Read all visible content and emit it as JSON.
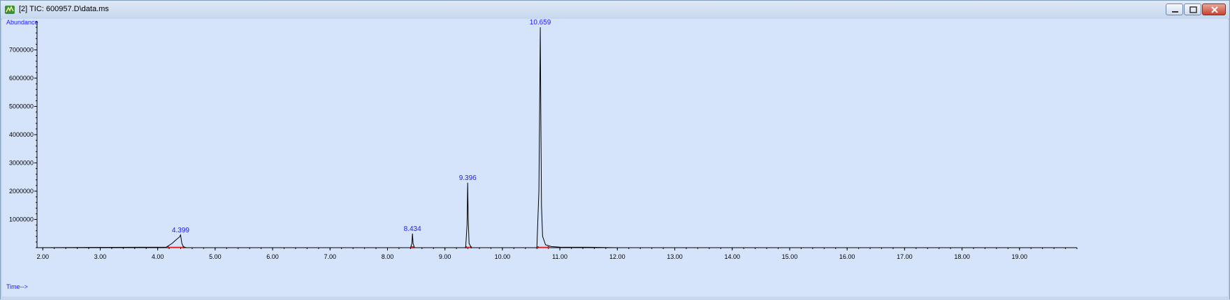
{
  "window": {
    "title": "[2] TIC: 600957.D\\data.ms",
    "icons": {
      "app": "chromatogram-app-icon",
      "minimize": "minimize-icon",
      "maximize": "maximize-icon",
      "close": "close-icon"
    }
  },
  "colors": {
    "plot_background": "#d6e4fb",
    "trace": "#000000",
    "labels": "#1a1aff",
    "baseline_markers": "#e02020"
  },
  "chart_data": {
    "type": "line",
    "title": "",
    "ylabel": "Abundance",
    "xlabel": "Time-->",
    "xlim": [
      1.9,
      20.0
    ],
    "ylim": [
      0,
      8000000
    ],
    "x_ticks": [
      "2.00",
      "3.00",
      "4.00",
      "5.00",
      "6.00",
      "7.00",
      "8.00",
      "9.00",
      "10.00",
      "11.00",
      "12.00",
      "13.00",
      "14.00",
      "15.00",
      "16.00",
      "17.00",
      "18.00",
      "19.00"
    ],
    "y_ticks": [
      "1000000",
      "2000000",
      "3000000",
      "4000000",
      "5000000",
      "6000000",
      "7000000"
    ],
    "grid": false,
    "series": [
      {
        "x": [
          1.9,
          4.15,
          4.25,
          4.32,
          4.38,
          4.399,
          4.42,
          4.45,
          4.5,
          8.4,
          8.425,
          8.434,
          8.445,
          8.47,
          9.36,
          9.385,
          9.396,
          9.405,
          9.42,
          9.46,
          10.6,
          10.635,
          10.648,
          10.659,
          10.668,
          10.68,
          10.7,
          10.75,
          10.85,
          11.0,
          11.5,
          12.0,
          14.5,
          20.0
        ],
        "y": [
          0,
          20000,
          150000,
          280000,
          380000,
          450000,
          150000,
          30000,
          0,
          0,
          150000,
          500000,
          150000,
          0,
          0,
          800000,
          2300000,
          1000000,
          150000,
          0,
          0,
          2000000,
          5000000,
          7800000,
          5000000,
          1500000,
          400000,
          100000,
          40000,
          20000,
          15000,
          0,
          0,
          0
        ]
      }
    ],
    "peaks": [
      {
        "label": "4.399",
        "x": 4.399,
        "y": 450000
      },
      {
        "label": "8.434",
        "x": 8.434,
        "y": 500000
      },
      {
        "label": "9.396",
        "x": 9.396,
        "y": 2300000
      },
      {
        "label": "10.659",
        "x": 10.659,
        "y": 7800000
      }
    ],
    "integration_ranges": [
      {
        "start": 4.18,
        "end": 4.45
      },
      {
        "start": 8.42,
        "end": 8.45
      },
      {
        "start": 9.37,
        "end": 9.45
      },
      {
        "start": 10.62,
        "end": 10.8
      }
    ]
  }
}
